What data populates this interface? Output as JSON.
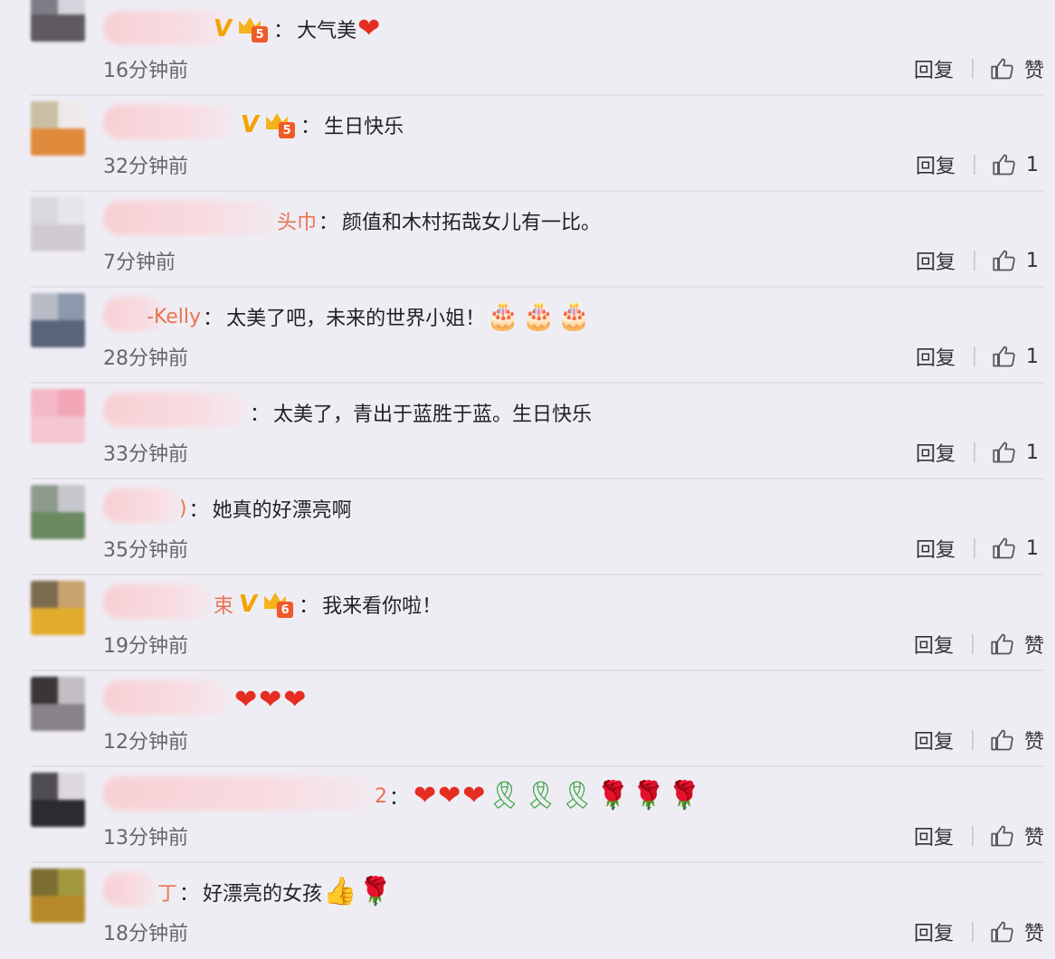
{
  "comments": [
    {
      "text": "大气美",
      "name_tail": "",
      "vip": true,
      "level": "5",
      "emojis": [
        "heart"
      ],
      "time": "16分钟前",
      "reply": "回复",
      "like": "赞"
    },
    {
      "text": "生日快乐",
      "name_tail": "",
      "vip": true,
      "level": "5",
      "emojis": [],
      "time": "32分钟前",
      "reply": "回复",
      "like": "1"
    },
    {
      "text": "颜值和木村拓哉女儿有一比。",
      "name_tail": "头巾",
      "vip": false,
      "level": "",
      "emojis": [],
      "time": "7分钟前",
      "reply": "回复",
      "like": "1"
    },
    {
      "text": "太美了吧，未来的世界小姐！",
      "name_tail": "-Kelly",
      "vip": false,
      "level": "",
      "emojis": [
        "cake",
        "cake",
        "cake"
      ],
      "time": "28分钟前",
      "reply": "回复",
      "like": "1"
    },
    {
      "text": "太美了，青出于蓝胜于蓝。生日快乐",
      "name_tail": "",
      "vip": false,
      "level": "",
      "emojis": [],
      "time": "33分钟前",
      "reply": "回复",
      "like": "1"
    },
    {
      "text": "她真的好漂亮啊",
      "name_tail": "",
      "vip": false,
      "level": "",
      "emojis": [],
      "time": "35分钟前",
      "reply": "回复",
      "like": "1"
    },
    {
      "text": "我来看你啦！",
      "name_tail": "束",
      "vip": true,
      "level": "6",
      "emojis": [],
      "time": "19分钟前",
      "reply": "回复",
      "like": "赞"
    },
    {
      "text": "",
      "name_tail": "",
      "vip": false,
      "level": "",
      "emojis": [
        "heart",
        "heart",
        "heart"
      ],
      "time": "12分钟前",
      "reply": "回复",
      "like": "赞"
    },
    {
      "text": "",
      "name_tail": "2",
      "vip": false,
      "level": "",
      "emojis": [
        "heart",
        "heart",
        "heart",
        "ribbon",
        "ribbon",
        "ribbon",
        "rose",
        "rose",
        "rose"
      ],
      "time": "13分钟前",
      "reply": "回复",
      "like": "赞"
    },
    {
      "text": "好漂亮的女孩",
      "name_tail": "",
      "vip": false,
      "level": "",
      "emojis": [
        "thumbsup",
        "rose"
      ],
      "time": "18分钟前",
      "reply": "回复",
      "like": "赞"
    }
  ],
  "colors": {
    "background": "#efedf4",
    "name": "#eb7350",
    "vip": "#f4a300",
    "time": "#666666"
  }
}
